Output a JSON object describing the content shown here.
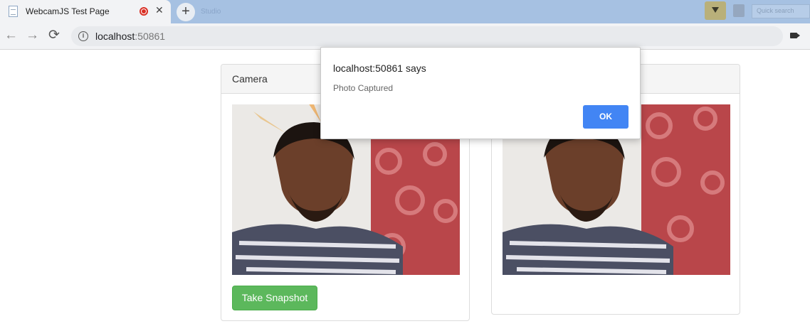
{
  "browser": {
    "tab_title": "WebcamJS Test Page",
    "tab_close": "✕",
    "new_tab": "+",
    "background_tab_hint": "Studio",
    "search_placeholder": "Quick search",
    "nav_back": "←",
    "nav_forward": "→",
    "nav_reload": "⟳",
    "url_host": "localhost",
    "url_port": ":50861",
    "info_icon": "i"
  },
  "page": {
    "camera_panel_title": "Camera",
    "snapshot_button": "Take Snapshot"
  },
  "alert": {
    "title": "localhost:50861 says",
    "message": "Photo Captured",
    "ok_label": "OK",
    "ok_color": "#4285f4"
  },
  "colors": {
    "success_button": "#5cb85c",
    "tab_strip": "#a6c1e2"
  }
}
